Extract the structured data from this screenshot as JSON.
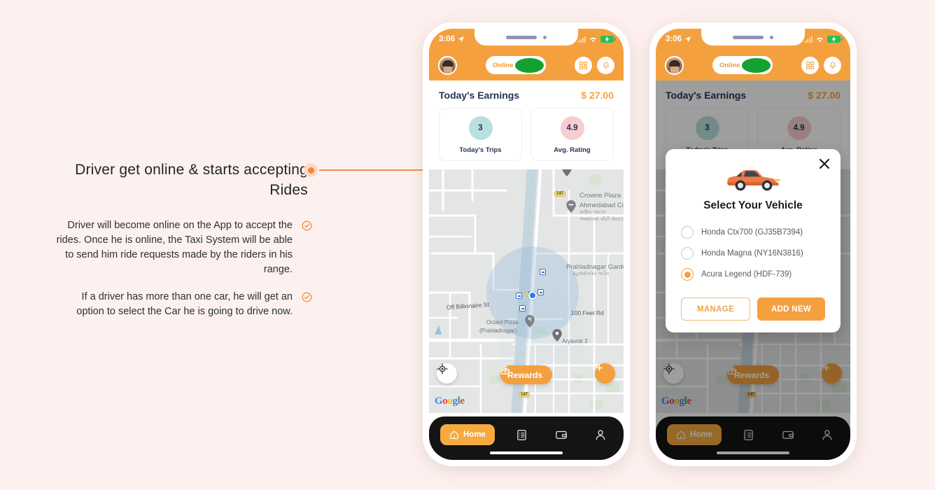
{
  "page": {
    "background": "#fdf1ef",
    "accent": "#f5a03f"
  },
  "annotation": {
    "headline": "Driver get online & starts accepting Rides",
    "bullets": [
      "Driver will become online on the App to accept the rides. Once he is online, the Taxi System will be able to send him ride requests made by the riders in his range.",
      "If a driver has more than one car, he will get an option to select the Car he is going to drive now."
    ],
    "check_icon": "check-circle-icon",
    "connector_icon": "connector-dot"
  },
  "phone": {
    "status_bar": {
      "time": "3:06",
      "location_icon": "location-arrow-icon",
      "signal_icon": "signal-bars-icon",
      "wifi_icon": "wifi-icon",
      "battery_icon": "battery-charging-icon"
    },
    "header": {
      "avatar": "driver-avatar",
      "online_label": "Online",
      "online_state": "on",
      "qr_icon": "qr-code-icon",
      "bell_icon": "bell-icon"
    },
    "earnings": {
      "label": "Today's Earnings",
      "value": "$ 27.00",
      "value_color": "#f5a53e"
    },
    "stats": [
      {
        "value": "3",
        "label": "Today's Trips",
        "bubble_color": "#b9e0de"
      },
      {
        "value": "4.9",
        "label": "Avg. Rating",
        "bubble_color": "#f8cdd0"
      }
    ],
    "map": {
      "labels": [
        "Crowne Plaza",
        "Ahmedabad City C",
        "Prahladnagar Garden",
        "Off Billionaire St",
        "100 Feet Rd",
        "Octant Pizza",
        "(Prahladnagar)",
        "Aryavrat 3"
      ],
      "gujarati_labels": [
        "ક્રાઉન પ્લાઝા",
        "અમદાવાદ સીટી સેન્ટર",
        "પ્રહલાદનગર ગાર્ડન"
      ],
      "highway_marker": "147",
      "rewards_label": "Rewards",
      "rewards_icon": "gift-icon",
      "locate_icon": "my-location-icon",
      "add_icon": "plus-icon",
      "attribution": "Google"
    },
    "bottom_nav": {
      "items": [
        {
          "label": "Home",
          "icon": "home-icon",
          "active": true
        },
        {
          "label": "",
          "icon": "orders-list-icon",
          "active": false
        },
        {
          "label": "",
          "icon": "wallet-icon",
          "active": false
        },
        {
          "label": "",
          "icon": "person-icon",
          "active": false
        }
      ]
    }
  },
  "modal": {
    "title": "Select Your Vehicle",
    "close_icon": "close-icon",
    "car_icon": "car-illustration",
    "vehicles": [
      {
        "label": "Honda Ctx700 (GJ35B7394)",
        "selected": false
      },
      {
        "label": "Honda Magna (NY16N3816)",
        "selected": false
      },
      {
        "label": "Acura Legend (HDF-739)",
        "selected": true
      }
    ],
    "manage_label": "MANAGE",
    "add_new_label": "ADD NEW"
  }
}
